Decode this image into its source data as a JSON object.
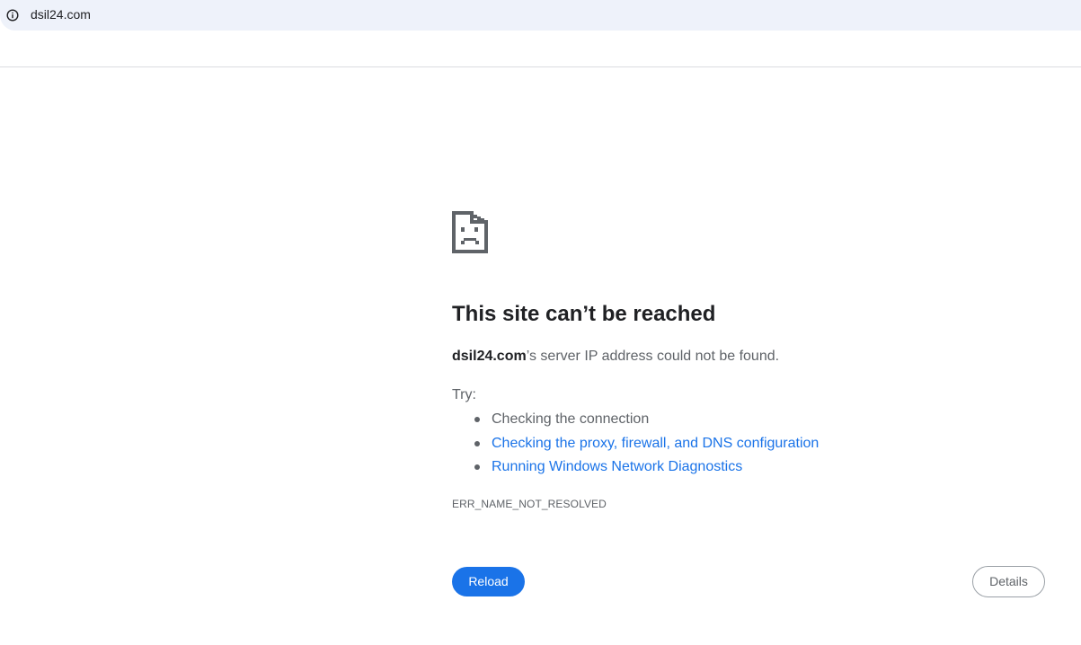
{
  "address_bar": {
    "url": "dsil24.com",
    "icon": "info-icon"
  },
  "error_page": {
    "icon": "sad-document-icon",
    "heading": "This site can’t be reached",
    "summary_host": "dsil24.com",
    "summary_rest": "’s server IP address could not be found.",
    "try_label": "Try:",
    "suggestions": [
      {
        "text": "Checking the connection",
        "link": false
      },
      {
        "text": "Checking the proxy, firewall, and DNS configuration",
        "link": true
      },
      {
        "text": "Running Windows Network Diagnostics",
        "link": true
      }
    ],
    "error_code": "ERR_NAME_NOT_RESOLVED",
    "reload_label": "Reload",
    "details_label": "Details"
  },
  "colors": {
    "accent": "#1a73e8",
    "address_bar_bg": "#eef2fa",
    "text_primary": "#202124",
    "text_secondary": "#5f6368"
  }
}
